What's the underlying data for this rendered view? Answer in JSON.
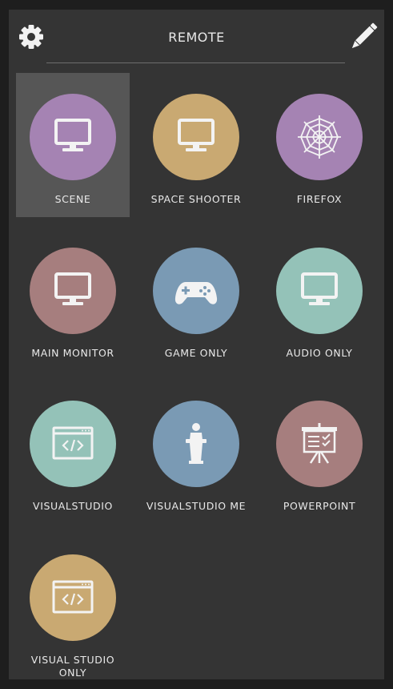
{
  "header": {
    "title": "REMOTE",
    "settings_icon": "gear-icon",
    "edit_icon": "pencil-icon"
  },
  "tiles": [
    {
      "label": "SCENE",
      "icon": "monitor-icon",
      "color": "#a583b3",
      "selected": true
    },
    {
      "label": "SPACE SHOOTER",
      "icon": "monitor-icon",
      "color": "#c9a972"
    },
    {
      "label": "FIREFOX",
      "icon": "spiderweb-icon",
      "color": "#a583b3"
    },
    {
      "label": "MAIN MONITOR",
      "icon": "monitor-icon",
      "color": "#a67e7e"
    },
    {
      "label": "GAME ONLY",
      "icon": "gamepad-icon",
      "color": "#7a9ab4"
    },
    {
      "label": "AUDIO ONLY",
      "icon": "monitor-icon",
      "color": "#94c2b8"
    },
    {
      "label": "VISUALSTUDIO",
      "icon": "code-window-icon",
      "color": "#94c2b8"
    },
    {
      "label": "VISUALSTUDIO ME",
      "icon": "podium-icon",
      "color": "#7a9ab4"
    },
    {
      "label": "POWERPOINT",
      "icon": "presentation-icon",
      "color": "#a67e7e"
    },
    {
      "label": "VISUAL STUDIO ONLY",
      "icon": "code-window-icon",
      "color": "#c9a972"
    }
  ]
}
